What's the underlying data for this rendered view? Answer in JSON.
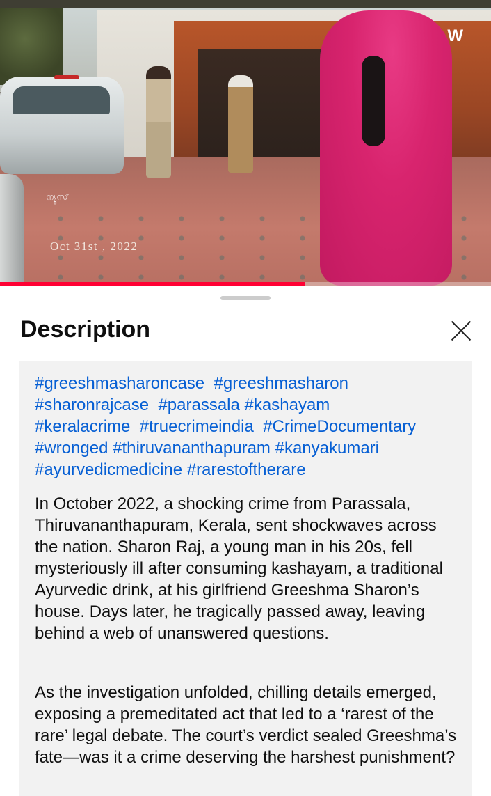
{
  "video": {
    "date_overlay": "Oct 31st , 2022",
    "channel_logo_text": "W",
    "watermark_text": "ന്യൂസ്",
    "progress": 0.62,
    "progress_color": "#ff0033"
  },
  "description": {
    "title": "Description",
    "close_icon": "close-icon",
    "hashtags": [
      "#greeshmasharoncase",
      "#greeshmasharon",
      "#sharonrajcase",
      "#parassala",
      "#kashayam",
      "#keralacrime",
      "#truecrimeindia",
      "#CrimeDocumentary",
      "#wronged",
      "#thiruvananthapuram",
      "#kanyakumari",
      "#ayurvedicmedicine",
      "#rarestoftherare"
    ],
    "paragraphs": [
      "In October 2022, a shocking crime from Parassala, Thiruvananthapuram, Kerala, sent shockwaves across the nation. Sharon Raj, a young man in his 20s, fell mysteriously ill after consuming kashayam, a traditional Ayurvedic drink, at his girlfriend Greeshma Sharon’s house. Days later, he tragically passed away, leaving behind a web of unanswered questions.",
      "As the investigation unfolded, chilling details emerged, exposing a premeditated act that led to a ‘rarest of the rare’ legal debate. The court’s verdict sealed Greeshma’s fate—was it a crime deserving the harshest punishment?"
    ],
    "link_color": "#065fd4"
  }
}
